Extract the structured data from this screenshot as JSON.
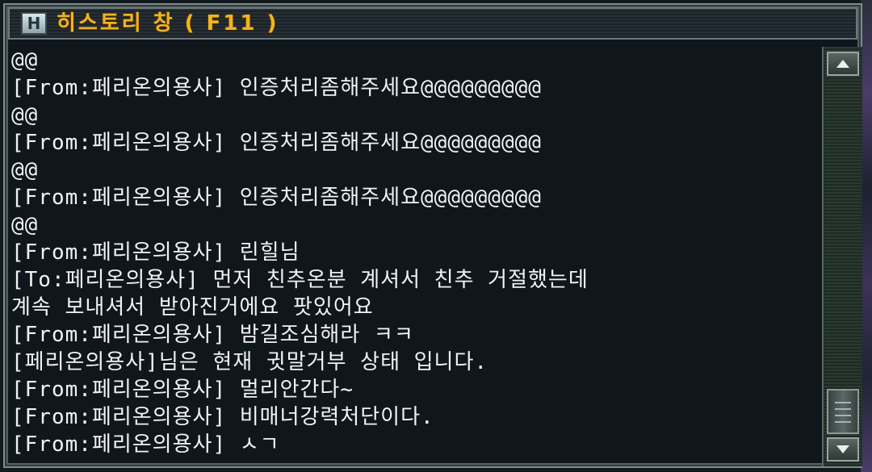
{
  "window": {
    "icon_letter": "H",
    "title": "히스토리 창 ( F11 )"
  },
  "log": {
    "lines": [
      "@@",
      "[From:페리온의용사] 인증처리좀해주세요@@@@@@@@@",
      "@@",
      "[From:페리온의용사] 인증처리좀해주세요@@@@@@@@@",
      "@@",
      "[From:페리온의용사] 인증처리좀해주세요@@@@@@@@@",
      "@@",
      "[From:페리온의용사] 린힐님",
      "[To:페리온의용사] 먼저 친추온분 계셔서 친추 거절했는데",
      "계속 보내셔서 받아진거에요 팟있어요",
      "[From:페리온의용사] 밤길조심해라 ㅋㅋ",
      "[페리온의용사]님은 현재 귓말거부 상태 입니다.",
      "[From:페리온의용사] 멀리안간다~",
      "[From:페리온의용사] 비매너강력처단이다.",
      "[From:페리온의용사] ㅅㄱ"
    ]
  },
  "scrollbar": {
    "up_icon": "scroll-up-arrow-icon",
    "down_icon": "scroll-down-arrow-icon",
    "position": 1.0
  },
  "colors": {
    "title": "#f0b424",
    "text": "#f2f2f2",
    "background": "#0f171d"
  }
}
